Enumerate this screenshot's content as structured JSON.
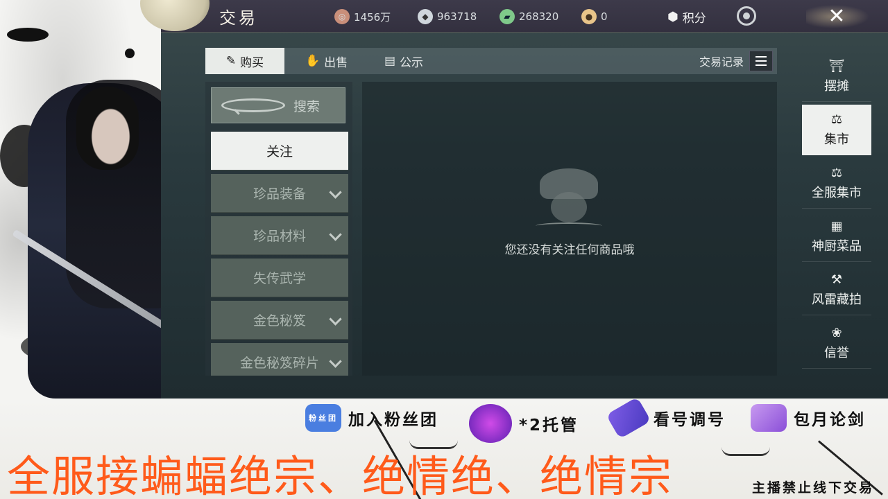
{
  "header": {
    "title": "交易",
    "currencies": [
      {
        "icon": "copper-coin-icon",
        "value": "1456万",
        "color": "#c98f7a"
      },
      {
        "icon": "silver-ingot-icon",
        "value": "963718",
        "color": "#cfd6dc"
      },
      {
        "icon": "jade-ticket-icon",
        "value": "268320",
        "color": "#7fc98a"
      },
      {
        "icon": "gold-pouch-icon",
        "value": "0",
        "color": "#e8c48a"
      }
    ],
    "points_label": "积分",
    "close_glyph": "✕"
  },
  "tabs": [
    {
      "label": "购买",
      "icon": "buy-icon"
    },
    {
      "label": "出售",
      "icon": "sell-icon"
    },
    {
      "label": "公示",
      "icon": "notice-icon"
    }
  ],
  "trade_record_label": "交易记录",
  "search": {
    "label": "搜索"
  },
  "categories": [
    {
      "label": "关注",
      "expandable": false
    },
    {
      "label": "珍品装备",
      "expandable": true
    },
    {
      "label": "珍品材料",
      "expandable": true
    },
    {
      "label": "失传武学",
      "expandable": false
    },
    {
      "label": "金色秘笈",
      "expandable": true
    },
    {
      "label": "金色秘笈碎片",
      "expandable": true
    }
  ],
  "empty_message": "您还没有关注任何商品哦",
  "side_nav": [
    {
      "label": "摆摊",
      "icon": "stall-icon"
    },
    {
      "label": "集市",
      "icon": "scale-icon"
    },
    {
      "label": "全服集市",
      "icon": "global-scale-icon"
    },
    {
      "label": "神厨菜品",
      "icon": "dish-icon"
    },
    {
      "label": "风雷藏拍",
      "icon": "gavel-icon"
    },
    {
      "label": "信誉",
      "icon": "credit-icon"
    }
  ],
  "promo": {
    "items": [
      {
        "badge_text": "粉丝团",
        "label": "加入粉丝团",
        "badge_color": "#4a7ee0"
      },
      {
        "badge_text": "",
        "label": "*2托管",
        "badge_color": "#8a3adf"
      },
      {
        "badge_text": "",
        "label": "看号调号",
        "badge_color": "#5d5fe0"
      },
      {
        "badge_text": "",
        "label": "包月论剑",
        "badge_color": "#b57be8"
      }
    ],
    "headline": "全服接蝙蝠绝宗、绝情绝、绝情宗",
    "notice": "主播禁止线下交易"
  }
}
